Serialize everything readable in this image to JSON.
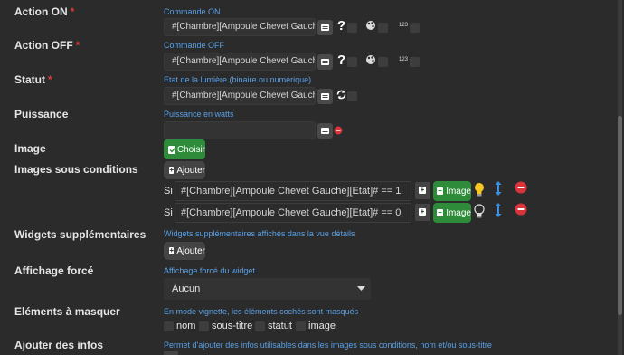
{
  "action_on": {
    "label": "Action ON",
    "required": "*",
    "help": "Commande ON",
    "value": "#[Chambre][Ampoule Chevet Gauche][On]#",
    "question": "?",
    "num_label": "123"
  },
  "action_off": {
    "label": "Action OFF",
    "required": "*",
    "help": "Commande OFF",
    "value": "#[Chambre][Ampoule Chevet Gauche][Off]#",
    "question": "?",
    "num_label": "123"
  },
  "statut": {
    "label": "Statut",
    "required": "*",
    "help": "Etat de la lumière (binaire ou numérique)",
    "value": "#[Chambre][Ampoule Chevet Gauche][Etat]"
  },
  "puissance": {
    "label": "Puissance",
    "help": "Puissance en watts",
    "value": ""
  },
  "image": {
    "label": "Image",
    "button": "Choisir"
  },
  "images_cond": {
    "label": "Images sous conditions",
    "add_button": "Ajouter",
    "rows": [
      {
        "si": "Si",
        "expr": "#[Chambre][Ampoule Chevet Gauche][Etat]# == 1",
        "image_button": "Image"
      },
      {
        "si": "Si",
        "expr": "#[Chambre][Ampoule Chevet Gauche][Etat]# == 0",
        "image_button": "Image"
      }
    ]
  },
  "widgets": {
    "label": "Widgets supplémentaires",
    "help": "Widgets supplémentaires affichés dans la vue détails",
    "add_button": "Ajouter"
  },
  "affichage": {
    "label": "Affichage forcé",
    "help": "Affichage forcé du widget",
    "selected": "Aucun"
  },
  "masquer": {
    "label": "Eléments à masquer",
    "help": "En mode vignette, les éléments cochés sont masqués",
    "options": [
      "nom",
      "sous-titre",
      "statut",
      "image"
    ]
  },
  "infos": {
    "label": "Ajouter des infos",
    "help": "Permet d'ajouter des infos utilisables dans les images sous conditions, nom et/ou sous-titre"
  },
  "colors": {
    "background": "#2b2b2b",
    "accent_green": "#2e8b3a",
    "help_blue": "#5aa0e6",
    "required_red": "#e03a3a",
    "delete_red": "#d9343a",
    "move_blue": "#3b8fe0"
  }
}
